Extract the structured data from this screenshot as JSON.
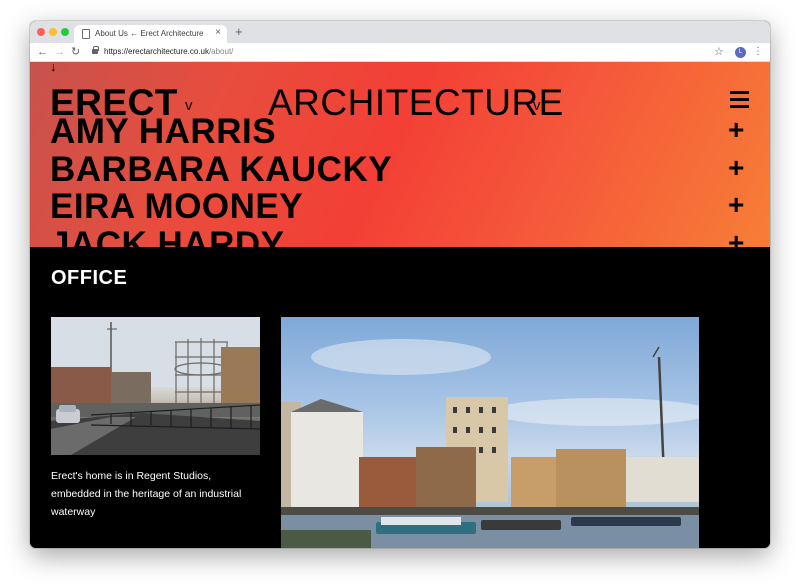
{
  "browser": {
    "tab_title": "About Us ← Erect Architecture",
    "tab_close": "×",
    "new_tab": "+",
    "url_host": "https://erectarchitecture.co.uk",
    "url_path": "/about/",
    "avatar_letter": "L",
    "icons": [
      "back-arrow-icon",
      "forward-arrow-icon",
      "reload-icon",
      "lock-icon",
      "star-icon",
      "kebab-menu-icon"
    ]
  },
  "site": {
    "scroll_arrow": "↓",
    "brand": {
      "word1": "ERECT",
      "word2": "ARCHITECTURE",
      "chevron": "v"
    },
    "menu_icon": "hamburger-icon",
    "people": [
      {
        "name": "AMY HARRIS",
        "expand": "+"
      },
      {
        "name": "BARBARA KAUCKY",
        "expand": "+"
      },
      {
        "name": "EIRA MOONEY",
        "expand": "+"
      },
      {
        "name": "JACK HARDY",
        "expand": "+"
      }
    ],
    "office": {
      "title": "OFFICE",
      "caption": "Erect's home is in Regent Studios, embedded in the heritage of an industrial waterway"
    },
    "colors": {
      "gradient_start": "#c7524d",
      "gradient_mid": "#f33f36",
      "gradient_end": "#f77e36",
      "page_bg": "#000000"
    }
  }
}
